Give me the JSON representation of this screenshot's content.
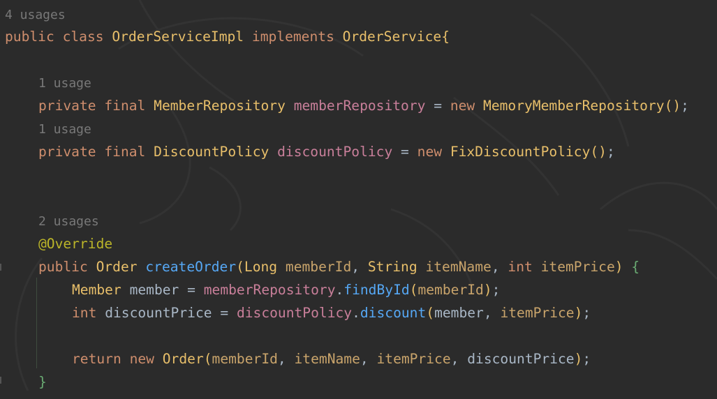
{
  "editor": {
    "colors": {
      "background": "#2b2b2b",
      "keyword": "#cf8e6d",
      "class_name": "#e8bf6a",
      "field": "#c77dbb",
      "method": "#56a8f5",
      "annotation": "#bbb529",
      "hint": "#787878"
    },
    "lines": [
      {
        "id": "l1",
        "tokens": [
          {
            "t": "4 usages",
            "c": "hint"
          }
        ]
      },
      {
        "id": "l2",
        "tokens": [
          {
            "t": "public class ",
            "c": "kw"
          },
          {
            "t": "OrderServiceImpl ",
            "c": "cls"
          },
          {
            "t": "implements ",
            "c": "kw"
          },
          {
            "t": "OrderService",
            "c": "cls"
          },
          {
            "t": "{",
            "c": "brace-y"
          }
        ]
      },
      {
        "id": "l3",
        "tokens": [
          {
            "t": "1 usage",
            "c": "hint"
          }
        ]
      },
      {
        "id": "l4",
        "tokens": [
          {
            "t": "private final ",
            "c": "kw"
          },
          {
            "t": "MemberRepository ",
            "c": "cls"
          },
          {
            "t": "memberRepository",
            "c": "fieldpink"
          },
          {
            "t": " = ",
            "c": "plain"
          },
          {
            "t": "new ",
            "c": "kw"
          },
          {
            "t": "MemoryMemberRepository",
            "c": "cls"
          },
          {
            "t": "()",
            "c": "brace-y"
          },
          {
            "t": ";",
            "c": "plain"
          }
        ]
      },
      {
        "id": "l5",
        "tokens": [
          {
            "t": "1 usage",
            "c": "hint"
          }
        ]
      },
      {
        "id": "l6",
        "tokens": [
          {
            "t": "private final ",
            "c": "kw"
          },
          {
            "t": "DiscountPolicy ",
            "c": "cls"
          },
          {
            "t": "discountPolicy",
            "c": "fieldpink"
          },
          {
            "t": " = ",
            "c": "plain"
          },
          {
            "t": "new ",
            "c": "kw"
          },
          {
            "t": "FixDiscountPolicy",
            "c": "cls"
          },
          {
            "t": "()",
            "c": "brace-y"
          },
          {
            "t": ";",
            "c": "plain"
          }
        ]
      },
      {
        "id": "l7",
        "tokens": [
          {
            "t": "2 usages",
            "c": "hint"
          }
        ]
      },
      {
        "id": "l8",
        "tokens": [
          {
            "t": "@Override",
            "c": "ann"
          }
        ]
      },
      {
        "id": "l9",
        "tokens": [
          {
            "t": "public ",
            "c": "kw"
          },
          {
            "t": "Order ",
            "c": "cls"
          },
          {
            "t": "createOrder",
            "c": "mcall"
          },
          {
            "t": "(",
            "c": "brace-y"
          },
          {
            "t": "Long ",
            "c": "cls"
          },
          {
            "t": "memberId",
            "c": "param"
          },
          {
            "t": ", ",
            "c": "plain"
          },
          {
            "t": "String ",
            "c": "cls"
          },
          {
            "t": "itemName",
            "c": "param"
          },
          {
            "t": ", ",
            "c": "plain"
          },
          {
            "t": "int ",
            "c": "kw"
          },
          {
            "t": "itemPrice",
            "c": "param"
          },
          {
            "t": ") ",
            "c": "brace-y"
          },
          {
            "t": "{",
            "c": "brace-g"
          }
        ]
      },
      {
        "id": "l10",
        "tokens": [
          {
            "t": "Member ",
            "c": "cls"
          },
          {
            "t": "member = ",
            "c": "plain"
          },
          {
            "t": "memberRepository",
            "c": "fieldpink"
          },
          {
            "t": ".",
            "c": "plain"
          },
          {
            "t": "findById",
            "c": "mcall"
          },
          {
            "t": "(",
            "c": "brace-y"
          },
          {
            "t": "memberId",
            "c": "param"
          },
          {
            "t": ")",
            "c": "brace-y"
          },
          {
            "t": ";",
            "c": "plain"
          }
        ]
      },
      {
        "id": "l11",
        "tokens": [
          {
            "t": "int ",
            "c": "kw"
          },
          {
            "t": "discountPrice = ",
            "c": "plain"
          },
          {
            "t": "discountPolicy",
            "c": "fieldpink"
          },
          {
            "t": ".",
            "c": "plain"
          },
          {
            "t": "discount",
            "c": "mcall"
          },
          {
            "t": "(",
            "c": "brace-y"
          },
          {
            "t": "member, ",
            "c": "plain"
          },
          {
            "t": "itemPrice",
            "c": "param"
          },
          {
            "t": ")",
            "c": "brace-y"
          },
          {
            "t": ";",
            "c": "plain"
          }
        ]
      },
      {
        "id": "l12",
        "tokens": [
          {
            "t": "return ",
            "c": "kw"
          },
          {
            "t": "new ",
            "c": "kw"
          },
          {
            "t": "Order",
            "c": "cls"
          },
          {
            "t": "(",
            "c": "brace-y"
          },
          {
            "t": "memberId",
            "c": "param"
          },
          {
            "t": ", ",
            "c": "plain"
          },
          {
            "t": "itemName",
            "c": "param"
          },
          {
            "t": ", ",
            "c": "plain"
          },
          {
            "t": "itemPrice",
            "c": "param"
          },
          {
            "t": ", ",
            "c": "plain"
          },
          {
            "t": "discountPrice",
            "c": "plain"
          },
          {
            "t": ")",
            "c": "brace-y"
          },
          {
            "t": ";",
            "c": "plain"
          }
        ]
      },
      {
        "id": "l13",
        "tokens": [
          {
            "t": "}",
            "c": "brace-g"
          }
        ]
      }
    ]
  }
}
